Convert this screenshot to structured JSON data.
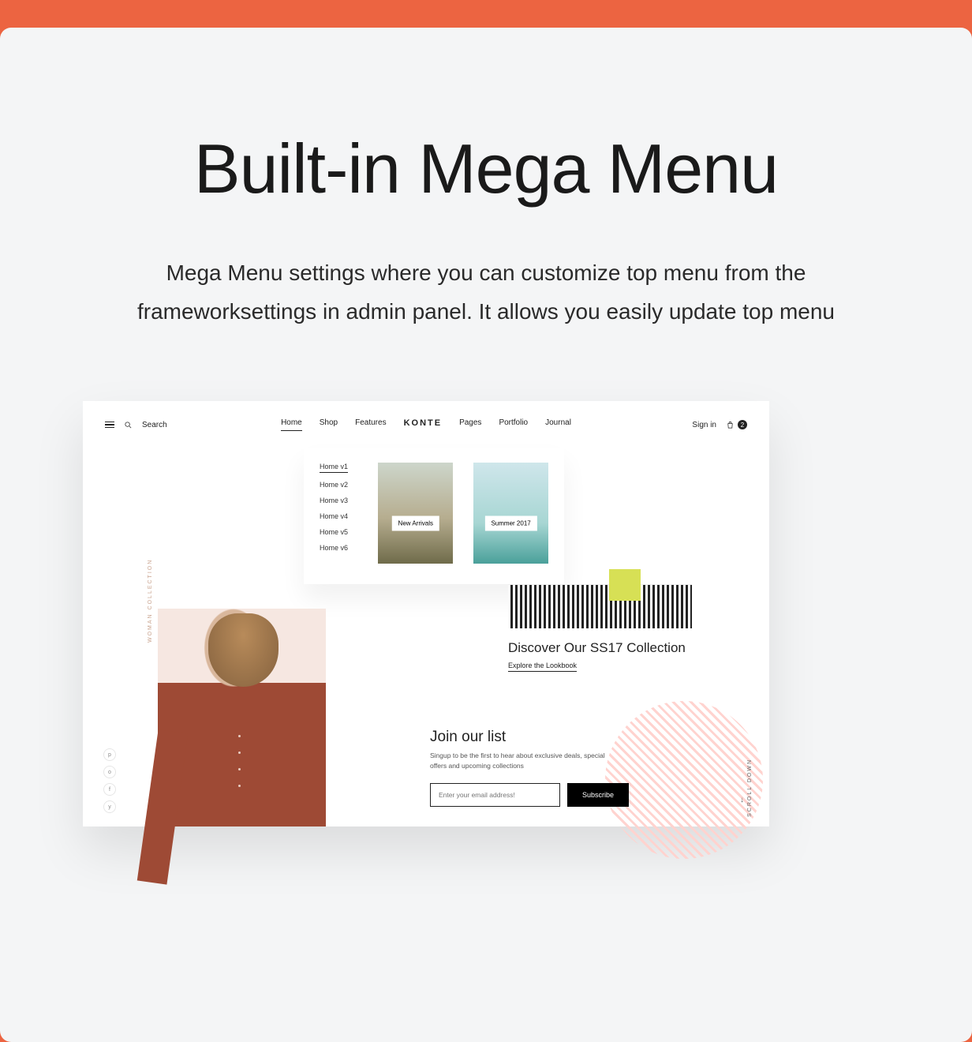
{
  "hero": {
    "title": "Built-in Mega Menu",
    "subtitle": "Mega Menu settings where you can customize top menu from the frameworksettings in admin panel. It allows you easily update top menu"
  },
  "preview": {
    "header": {
      "search_label": "Search",
      "nav": {
        "items": [
          "Home",
          "Shop",
          "Features",
          "Pages",
          "Portfolio",
          "Journal"
        ],
        "logo": "KONTE",
        "active": "Home"
      },
      "signin": "Sign in",
      "bag_count": "2"
    },
    "mega": {
      "list": [
        {
          "label": "Home v1",
          "active": true
        },
        {
          "label": "Home v2",
          "active": false
        },
        {
          "label": "Home v3",
          "active": false
        },
        {
          "label": "Home v4",
          "active": false
        },
        {
          "label": "Home v5",
          "active": false
        },
        {
          "label": "Home v6",
          "active": false
        }
      ],
      "cards": [
        {
          "label": "New Arrivals"
        },
        {
          "label": "Summer 2017"
        }
      ]
    },
    "side_label": "WOMAN COLLECTION",
    "ss17": {
      "title": "Discover Our SS17 Collection",
      "link": "Explore the Lookbook"
    },
    "join": {
      "title": "Join our list",
      "subtitle": "Singup to be the first to hear about exclusive deals, special offers and upcoming collections",
      "placeholder": "Enter your email address!",
      "button": "Subscribe"
    },
    "scroll_label": "SCROLL DOWN",
    "social": [
      "p",
      "o",
      "f",
      "y"
    ]
  }
}
